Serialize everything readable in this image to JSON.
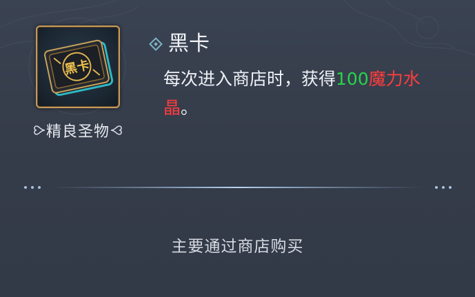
{
  "item": {
    "name": "黑卡",
    "quality": "精良圣物",
    "description": {
      "part1": "每次进入商店时，获得",
      "amount": "100",
      "resource": "魔力水晶",
      "end": "。"
    },
    "card_glyph": "黑卡",
    "source": "主要通过商店购买"
  },
  "colors": {
    "background": "#353c4a",
    "frame_gold": "#c79a5a",
    "amount_green": "#27d44a",
    "resource_red": "#ff3d3d"
  },
  "icons": [
    "diamond-bullet-icon",
    "black-card-icon",
    "flourish-left-icon",
    "flourish-right-icon",
    "dots-icon"
  ]
}
